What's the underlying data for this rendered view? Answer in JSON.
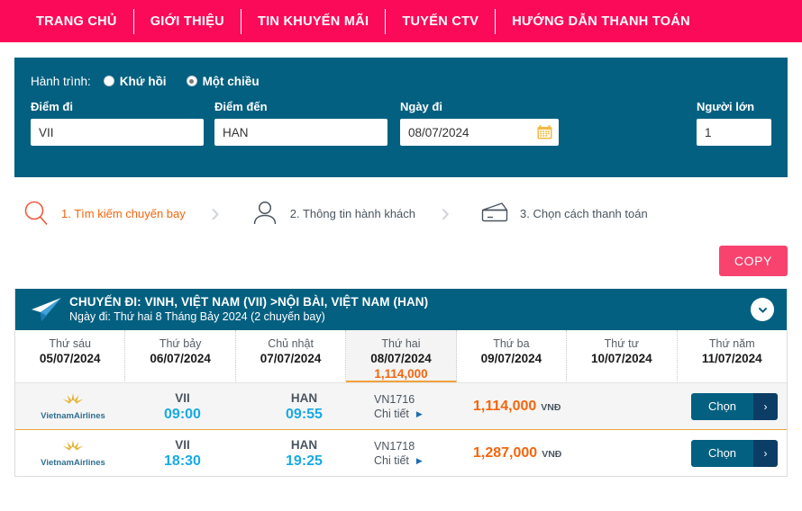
{
  "nav": {
    "items": [
      {
        "label": "TRANG CHỦ"
      },
      {
        "label": "GIỚI THIỆU"
      },
      {
        "label": "TIN KHUYẾN MÃI"
      },
      {
        "label": "TUYẾN CTV"
      },
      {
        "label": "HƯỚNG DẪN THANH TOÁN"
      }
    ]
  },
  "search": {
    "trip_label": "Hành trình:",
    "trip_options": [
      {
        "label": "Khứ hồi",
        "selected": false
      },
      {
        "label": "Một chiều",
        "selected": true
      }
    ],
    "origin": {
      "label": "Điểm đi",
      "value": "VII"
    },
    "destination": {
      "label": "Điểm đến",
      "value": "HAN"
    },
    "date": {
      "label": "Ngày đi",
      "value": "08/07/2024",
      "icon": "calendar-icon"
    },
    "adults": {
      "label": "Người lớn",
      "value": "1"
    }
  },
  "steps": [
    {
      "icon": "search-icon",
      "label": "1. Tìm kiếm chuyến bay",
      "active": true
    },
    {
      "icon": "user-icon",
      "label": "2. Thông tin hành khách",
      "active": false
    },
    {
      "icon": "card-icon",
      "label": "3. Chọn cách thanh toán",
      "active": false
    }
  ],
  "step_separator": "›",
  "toolbar": {
    "copy_label": "COPY"
  },
  "flight_banner": {
    "icon": "paper-plane-icon",
    "title": "CHUYẾN ĐI: VINH, VIỆT NAM (VII) >NỘI BÀI, VIỆT NAM (HAN)",
    "subtitle": "Ngày đi: Thứ hai 8 Tháng Bảy 2024 (2 chuyến bay)",
    "collapse_icon": "chevron-down-icon"
  },
  "date_strip": [
    {
      "dow": "Thứ sáu",
      "date": "05/07/2024",
      "price": "",
      "active": false
    },
    {
      "dow": "Thứ bảy",
      "date": "06/07/2024",
      "price": "",
      "active": false
    },
    {
      "dow": "Chủ nhật",
      "date": "07/07/2024",
      "price": "",
      "active": false
    },
    {
      "dow": "Thứ hai",
      "date": "08/07/2024",
      "price": "1,114,000",
      "active": true
    },
    {
      "dow": "Thứ ba",
      "date": "09/07/2024",
      "price": "",
      "active": false
    },
    {
      "dow": "Thứ tư",
      "date": "10/07/2024",
      "price": "",
      "active": false
    },
    {
      "dow": "Thứ năm",
      "date": "11/07/2024",
      "price": "",
      "active": false
    }
  ],
  "flights": [
    {
      "airline": "VietnamAirlines",
      "origin_code": "VII",
      "depart_time": "09:00",
      "dest_code": "HAN",
      "arrive_time": "09:55",
      "flight_no": "VN1716",
      "detail_label": "Chi tiết",
      "price": "1,114,000",
      "currency": "VNĐ",
      "select_label": "Chọn",
      "select_arrow": "›"
    },
    {
      "airline": "VietnamAirlines",
      "origin_code": "VII",
      "depart_time": "18:30",
      "dest_code": "HAN",
      "arrive_time": "19:25",
      "flight_no": "VN1718",
      "detail_label": "Chi tiết",
      "price": "1,287,000",
      "currency": "VNĐ",
      "select_label": "Chọn",
      "select_arrow": "›"
    }
  ],
  "colors": {
    "nav_pink": "#fc0a5a",
    "panel_teal": "#046080",
    "accent_orange": "#f4650d",
    "time_blue": "#18aae4",
    "copy_pink": "#f8436f"
  }
}
